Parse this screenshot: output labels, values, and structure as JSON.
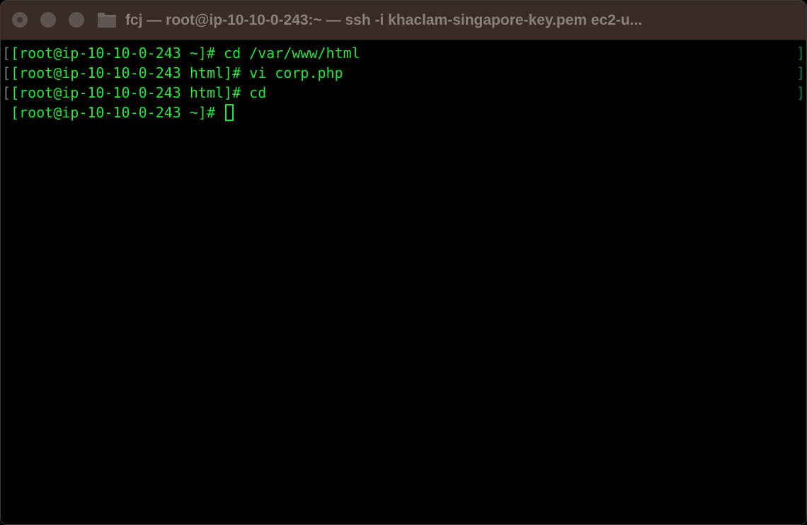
{
  "window": {
    "title": "fcj — root@ip-10-10-0-243:~ — ssh -i khaclam-singapore-key.pem ec2-u..."
  },
  "terminal": {
    "lines": [
      {
        "prompt": "[root@ip-10-10-0-243 ~]# ",
        "command": "cd /var/www/html"
      },
      {
        "prompt": "[root@ip-10-10-0-243 html]# ",
        "command": "vi corp.php"
      },
      {
        "prompt": "[root@ip-10-10-0-243 html]# ",
        "command": "cd"
      },
      {
        "prompt": "[root@ip-10-10-0-243 ~]# ",
        "command": ""
      }
    ],
    "text_color": "#22e53a",
    "background": "#000000"
  },
  "icons": {
    "close": "close-light-icon",
    "minimize": "minimize-light-icon",
    "zoom": "zoom-light-icon",
    "folder": "folder-icon"
  }
}
